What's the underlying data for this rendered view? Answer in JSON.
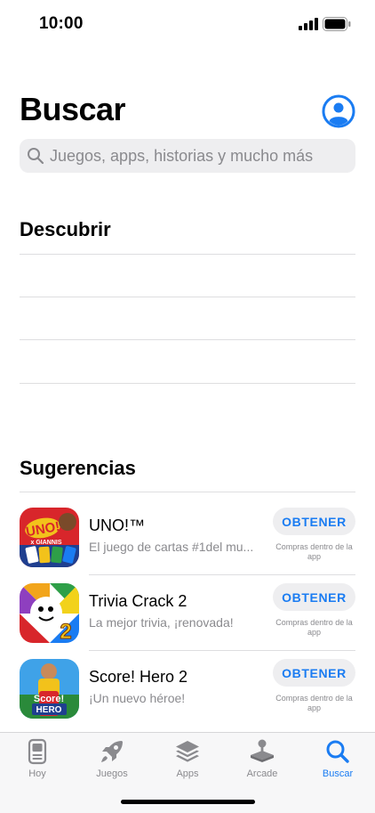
{
  "status_bar": {
    "time": "10:00"
  },
  "header": {
    "title": "Buscar"
  },
  "search": {
    "placeholder": "Juegos, apps, historias y mucho más"
  },
  "discover": {
    "title": "Descubrir"
  },
  "suggestions": {
    "title": "Sugerencias",
    "items": [
      {
        "name": "UNO!™",
        "subtitle": "El juego de cartas #1del mu...",
        "button": "OBTENER",
        "note": "Compras dentro de la app",
        "icon_text_top": "UNO!",
        "icon_text_sub": "x GIANNIS"
      },
      {
        "name": "Trivia Crack 2",
        "subtitle": "La mejor trivia, ¡renovada!",
        "button": "OBTENER",
        "note": "Compras dentro de la app",
        "icon_text_top": "2"
      },
      {
        "name": "Score! Hero 2",
        "subtitle": "¡Un nuevo héroe!",
        "button": "OBTENER",
        "note": "Compras dentro de la app",
        "icon_text_top": "Score!",
        "icon_text_sub": "HERO"
      }
    ]
  },
  "tabs": [
    {
      "label": "Hoy",
      "icon": "today-icon"
    },
    {
      "label": "Juegos",
      "icon": "rocket-icon"
    },
    {
      "label": "Apps",
      "icon": "layers-icon"
    },
    {
      "label": "Arcade",
      "icon": "joystick-icon"
    },
    {
      "label": "Buscar",
      "icon": "search-icon",
      "active": true
    }
  ],
  "colors": {
    "accent": "#1a7cf2",
    "secondary_text": "#8a8a8e"
  }
}
